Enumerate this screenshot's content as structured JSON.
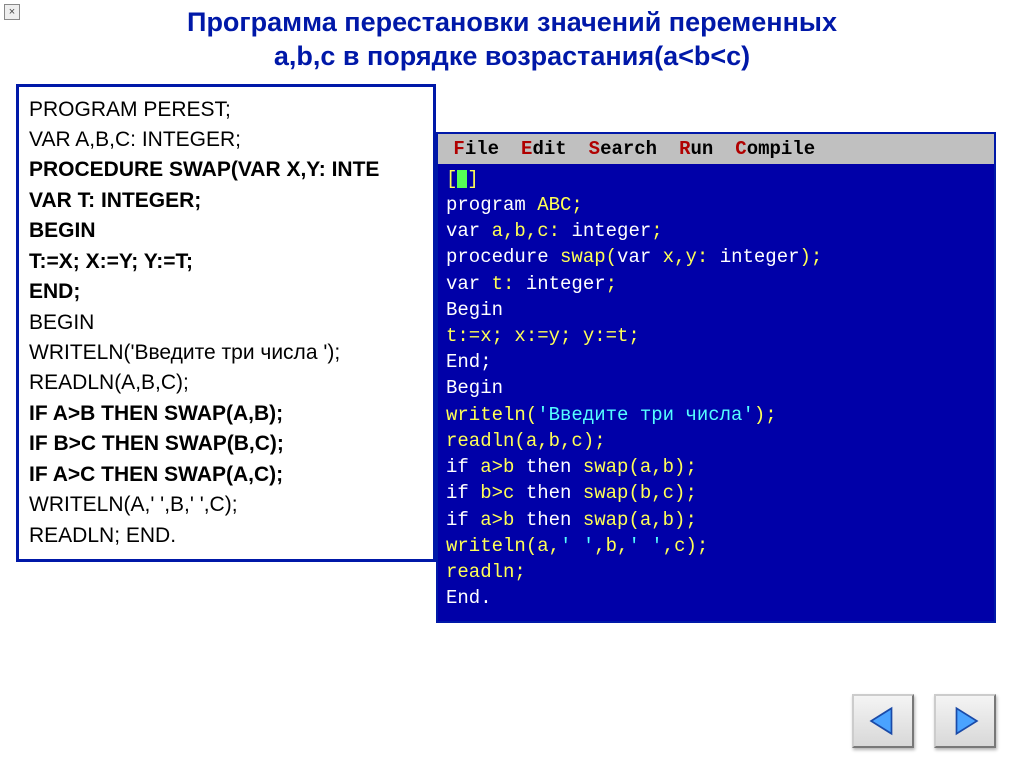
{
  "cancel_mark": "×",
  "title_line1": "Программа перестановки значений переменных",
  "title_line2": "a,b,c в порядке возрастания(a<b<c)",
  "code_left": {
    "l1": "PROGRAM PEREST;",
    "l2": "VAR A,B,C: INTEGER;",
    "l3": "PROCEDURE SWAP(VAR X,Y: INTE",
    "l4": "VAR T: INTEGER;",
    "l5": "BEGIN",
    "l6": "T:=X; X:=Y; Y:=T;",
    "l7": "END;",
    "l8": "BEGIN",
    "l9": "WRITELN('Введите три числа ');",
    "l10": "READLN(A,B,C);",
    "l11": "IF A>B THEN SWAP(A,B);",
    "l12": "IF B>C THEN SWAP(B,C);",
    "l13": "IF A>C THEN SWAP(A,C);",
    "l14": "WRITELN(A,' ',B,' ',C);",
    "l15": "READLN;  END."
  },
  "ide_menu": {
    "file": "File",
    "edit": "Edit",
    "search": "Search",
    "run": "Run",
    "compile": "Compile"
  },
  "ide_code": {
    "bracket_open": "[",
    "bracket_close": "]",
    "l1_a": "program",
    "l1_b": " ABC;",
    "l2_a": "var",
    "l2_b": " a,b,c: ",
    "l2_c": "integer",
    "l2_d": ";",
    "l3_a": "procedure",
    "l3_b": " swap(",
    "l3_c": "var",
    "l3_d": " x,y: ",
    "l3_e": "integer",
    "l3_f": ");",
    "l4_a": "var",
    "l4_b": " t: ",
    "l4_c": "integer",
    "l4_d": ";",
    "l5": "Begin",
    "l6": "t:=x; x:=y; y:=t;",
    "l7": "End;",
    "l8": "Begin",
    "l9_a": "writeln(",
    "l9_b": "'Введите три числа'",
    "l9_c": ");",
    "l10": "readln(a,b,c);",
    "l11_a": "if",
    "l11_b": " a>b ",
    "l11_c": "then",
    "l11_d": " swap(a,b);",
    "l12_a": "if",
    "l12_b": " b>c ",
    "l12_c": "then",
    "l12_d": " swap(b,c);",
    "l13_a": "if",
    "l13_b": " a>b ",
    "l13_c": "then",
    "l13_d": " swap(a,b);",
    "l14_a": "writeln(a,",
    "l14_b": "' '",
    "l14_c": ",b,",
    "l14_d": "' '",
    "l14_e": ",c);",
    "l15": "readln;",
    "l16": "End."
  }
}
